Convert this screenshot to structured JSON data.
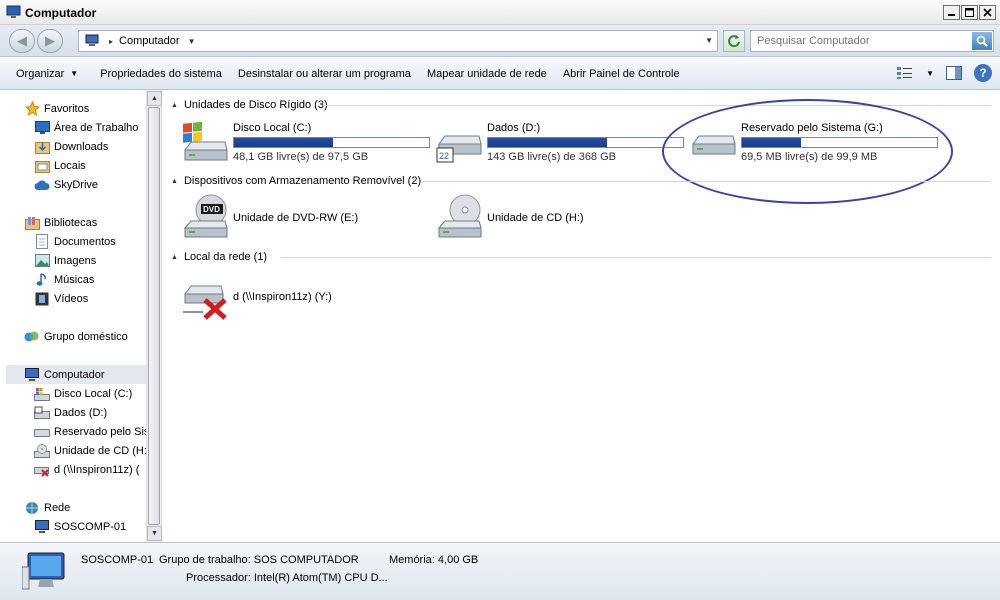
{
  "window": {
    "title": "Computador",
    "controls": {
      "minimize": "_",
      "maximize": "□",
      "close": "✕"
    }
  },
  "address_bar": {
    "breadcrumb": "Computador",
    "search_placeholder": "Pesquisar Computador"
  },
  "toolbar": {
    "organize": "Organizar",
    "system_properties": "Propriedades do sistema",
    "uninstall": "Desinstalar ou alterar um programa",
    "map_drive": "Mapear unidade de rede",
    "control_panel": "Abrir Painel de Controle"
  },
  "nav": {
    "favorites": "Favoritos",
    "desktop": "Área de Trabalho",
    "downloads": "Downloads",
    "places": "Locais",
    "skydrive": "SkyDrive",
    "libraries": "Bibliotecas",
    "documents": "Documentos",
    "pictures": "Imagens",
    "music": "Músicas",
    "videos": "Vídeos",
    "homegroup": "Grupo doméstico",
    "computer": "Computador",
    "drive_c": "Disco Local (C:)",
    "drive_d": "Dados (D:)",
    "drive_g": "Reservado pelo Sis",
    "drive_h": "Unidade de CD (H:)",
    "drive_y": "d (\\\\Inspiron11z) (",
    "network": "Rede",
    "soscomp": "SOSCOMP-01"
  },
  "groups": {
    "hard_disks": "Unidades de Disco Rígido (3)",
    "removable": "Dispositivos com Armazenamento Removível (2)",
    "network": "Local da rede (1)"
  },
  "drives": {
    "c": {
      "name": "Disco Local (C:)",
      "free_text": "48,1 GB livre(s) de 97,5 GB",
      "used_fraction": 0.507
    },
    "d": {
      "name": "Dados (D:)",
      "free_text": "143 GB livre(s) de 368 GB",
      "used_fraction": 0.611
    },
    "g": {
      "name": "Reservado pelo Sistema (G:)",
      "free_text": "69,5 MB livre(s) de 99,9 MB",
      "used_fraction": 0.304
    },
    "e": {
      "name": "Unidade de DVD-RW (E:)"
    },
    "h": {
      "name": "Unidade de CD (H:)"
    },
    "y": {
      "name": "d (\\\\Inspiron11z) (Y:)"
    }
  },
  "details": {
    "computer_name": "SOSCOMP-01",
    "workgroup": "Grupo de trabalho: SOS COMPUTADOR",
    "memory": "Memória: 4,00 GB",
    "processor": "Processador: Intel(R) Atom(TM) CPU D..."
  },
  "colors": {
    "usage_bar": "#1d469a",
    "annotation_ellipse": "#3744a0",
    "selected_nav": "#e3e8ef"
  }
}
